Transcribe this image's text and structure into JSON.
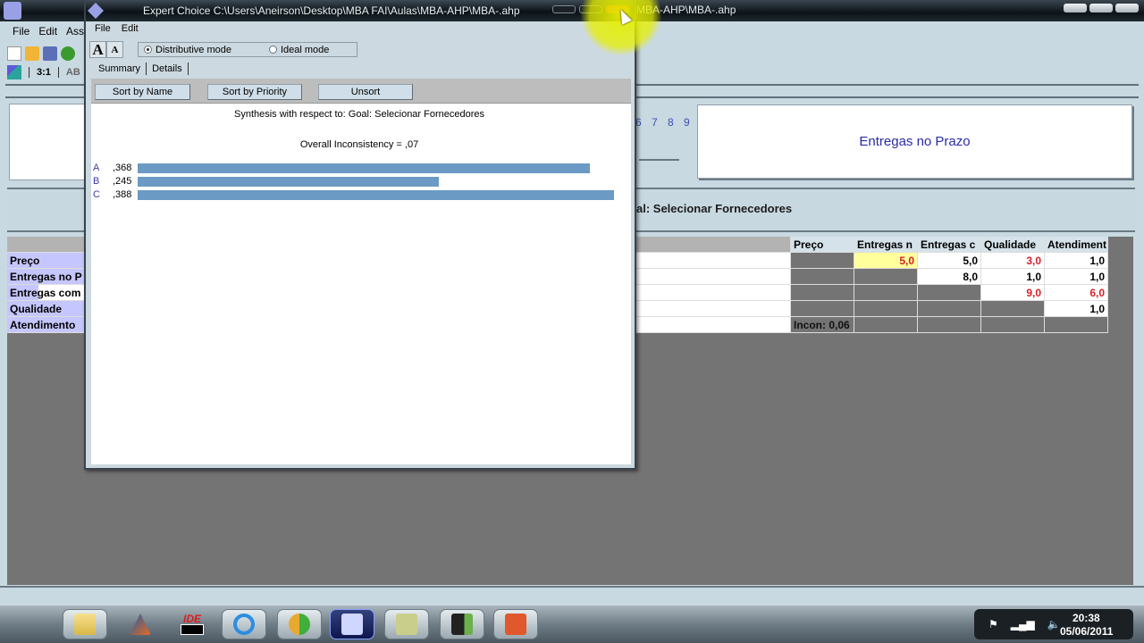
{
  "main_window": {
    "title_tail": "MBA-AHP\\MBA-.ahp",
    "menu": [
      "File",
      "Edit",
      "Asse"
    ],
    "tabs": [
      "3:1",
      "AB"
    ],
    "scale_numbers": "6 7 8 9",
    "compare_label": "Entregas no Prazo",
    "goal_text": "al: Selecionar Fornecedores",
    "row_headers": [
      "Preço",
      "Entregas no P",
      "Entregas com",
      "Qualidade",
      "Atendimento"
    ],
    "matrix": {
      "columns": [
        "Preço",
        "Entregas n",
        "Entregas c",
        "Qualidade",
        "Atendiment"
      ],
      "rows": [
        [
          "",
          "5,0",
          "5,0",
          "3,0",
          "1,0"
        ],
        [
          "",
          "",
          "8,0",
          "1,0",
          "1,0"
        ],
        [
          "",
          "",
          "",
          "9,0",
          "6,0"
        ],
        [
          "",
          "",
          "",
          "",
          "1,0"
        ]
      ],
      "inconsistency": "Incon: 0,06"
    }
  },
  "dialog": {
    "title": "Expert Choice    C:\\Users\\Aneirson\\Desktop\\MBA FAI\\Aulas\\MBA-AHP\\MBA-.ahp",
    "menu": [
      "File",
      "Edit"
    ],
    "font_buttons": [
      "A",
      "A"
    ],
    "modes": [
      {
        "label": "Distributive mode",
        "checked": true
      },
      {
        "label": "Ideal mode",
        "checked": false
      }
    ],
    "tabs": [
      "Summary",
      "Details"
    ],
    "sort_buttons": [
      "Sort by Name",
      "Sort by Priority",
      "Unsort"
    ],
    "synthesis_title": "Synthesis with respect to: Goal: Selecionar Fornecedores",
    "overall_inconsistency": "Overall Inconsistency = ,07",
    "alternatives": [
      {
        "name": "A",
        "value_label": ",368",
        "value": 0.368
      },
      {
        "name": "B",
        "value_label": ",245",
        "value": 0.245
      },
      {
        "name": "C",
        "value_label": ",388",
        "value": 0.388
      }
    ],
    "bar_color": "#6b9ac4"
  },
  "taskbar": {
    "apps": [
      "file-explorer",
      "matlab",
      "ide",
      "internet-explorer",
      "messenger",
      "expert-choice",
      "sticky-notes",
      "camcorder",
      "powerpoint"
    ],
    "active_app": "expert-choice",
    "ide_label": "IDE",
    "tray_icons": [
      "flag-icon",
      "signal-icon",
      "volume-icon"
    ],
    "time": "20:38",
    "date": "05/06/2011"
  }
}
